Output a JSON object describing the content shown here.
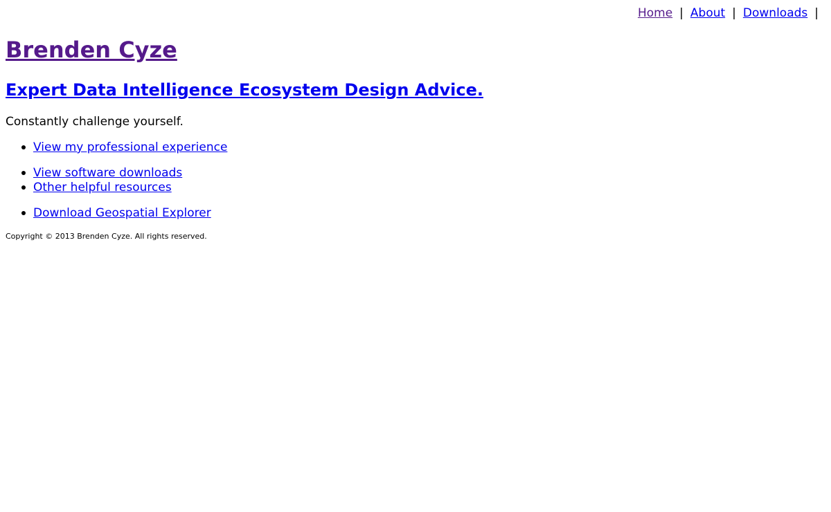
{
  "nav": {
    "items": [
      {
        "label": "Home"
      },
      {
        "label": "About"
      },
      {
        "label": "Downloads"
      }
    ],
    "separator": "|"
  },
  "site_title": "Brenden Cyze",
  "tagline": "Expert Data Intelligence Ecosystem Design Advice.",
  "motto": "Constantly challenge yourself.",
  "links": [
    {
      "label": "View my professional experience"
    },
    {
      "label": "View software downloads"
    },
    {
      "label": "Other helpful resources"
    },
    {
      "label": "Download Geospatial Explorer"
    }
  ],
  "footer": {
    "copyright": "Copyright © 2013 Brenden Cyze. All rights reserved."
  },
  "colors": {
    "link": "#0000ee",
    "visited_link": "#551a8b",
    "text": "#000000",
    "background": "#ffffff"
  }
}
